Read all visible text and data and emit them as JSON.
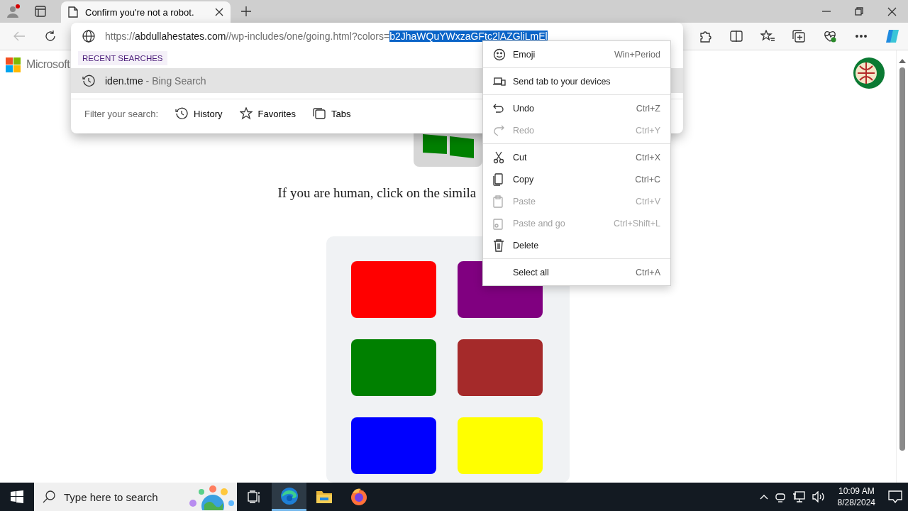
{
  "tabs": [
    {
      "title": "Confirm you're not a robot.",
      "selected": true
    }
  ],
  "omnibox": {
    "url_scheme": "https://",
    "url_host": "abdullahestates.com",
    "url_path": "//wp-includes/one/going.html?colors=",
    "url_selected": "b2JhaWQuYWxzaGFtc2lAZGliLmEl",
    "section_label": "RECENT SEARCHES",
    "suggestions": [
      {
        "text": "iden.tme",
        "suffix": " - Bing Search",
        "selected": true
      }
    ],
    "filter_label": "Filter your search:",
    "filters": [
      "History",
      "Favorites",
      "Tabs"
    ]
  },
  "context_menu": {
    "groups": [
      [
        {
          "label": "Emoji",
          "shortcut": "Win+Period",
          "disabled": false
        }
      ],
      [
        {
          "label": "Send tab to your devices",
          "disabled": false
        }
      ],
      [
        {
          "label": "Undo",
          "shortcut": "Ctrl+Z",
          "disabled": false
        },
        {
          "label": "Redo",
          "shortcut": "Ctrl+Y",
          "disabled": true
        }
      ],
      [
        {
          "label": "Cut",
          "shortcut": "Ctrl+X",
          "disabled": false
        },
        {
          "label": "Copy",
          "shortcut": "Ctrl+C",
          "disabled": false
        },
        {
          "label": "Paste",
          "shortcut": "Ctrl+V",
          "disabled": true
        },
        {
          "label": "Paste and go",
          "shortcut": "Ctrl+Shift+L",
          "disabled": true
        },
        {
          "label": "Delete",
          "disabled": false
        }
      ],
      [
        {
          "label": "Select all",
          "shortcut": "Ctrl+A",
          "disabled": false
        }
      ]
    ]
  },
  "page": {
    "logo_text": "Microsoft",
    "prompt": "If you are human, click on the simila",
    "color_tiles": [
      {
        "color": "#ff0000"
      },
      {
        "color": "#800080"
      },
      {
        "color": "#008000"
      },
      {
        "color": "#a52a2a"
      },
      {
        "color": "#0000ff"
      },
      {
        "color": "#ffff00"
      }
    ]
  },
  "taskbar": {
    "search_placeholder": "Type here to search",
    "apps": [
      {
        "selected": false
      },
      {
        "selected": true
      },
      {
        "selected": false
      },
      {
        "selected": false
      }
    ],
    "time": "10:09 AM",
    "date": "8/28/2024"
  }
}
